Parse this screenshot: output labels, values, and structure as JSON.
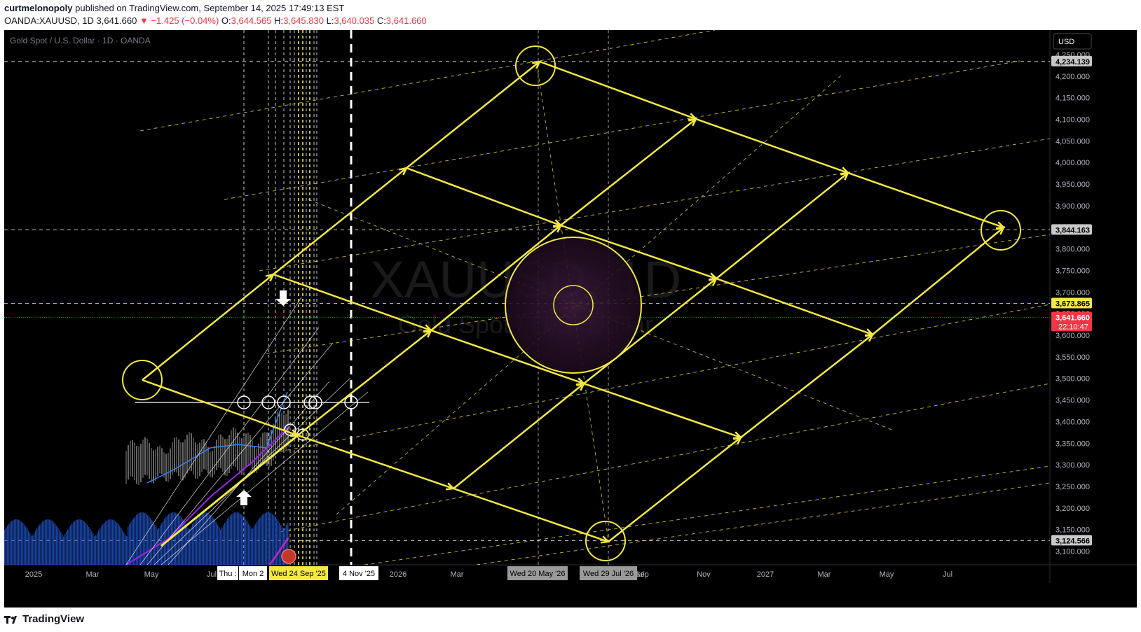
{
  "header": {
    "publisher": "curtmelonopoly",
    "published_text": "published on TradingView.com, September 14, 2025 17:49:13 EST"
  },
  "ohlc": {
    "symbol": "OANDA:XAUUSD, 1D",
    "last": "3,641.660",
    "change": "▼ −1.425 (−0.04%)",
    "o_label": "O:",
    "o": "3,644.565",
    "h_label": "H:",
    "h": "3,645.830",
    "l_label": "L:",
    "l": "3,640.035",
    "c_label": "C:",
    "c": "3,641.660"
  },
  "legend_title": "Gold Spot / U.S. Dollar · 1D · OANDA",
  "watermark": {
    "symbol": "XAUUSD, 1D",
    "name": "Gold Spot / U.S. Dollar"
  },
  "currency_button": "USD",
  "chart_data": {
    "type": "line",
    "title": "Gold Spot / U.S. Dollar · 1D · OANDA",
    "y_axis": {
      "ylim": [
        3060,
        4280
      ],
      "ticks": [
        4250,
        4200,
        4150,
        4100,
        4050,
        4000,
        3950,
        3900,
        3850,
        3800,
        3750,
        3700,
        3650,
        3600,
        3550,
        3500,
        3450,
        3400,
        3350,
        3300,
        3250,
        3200,
        3150,
        3100
      ],
      "tick_labels": [
        "4,250.000",
        "4,200.000",
        "4,150.000",
        "4,100.000",
        "4,050.000",
        "4,000.000",
        "3,950.000",
        "3,900.000",
        "3,850.000",
        "3,800.000",
        "3,750.000",
        "3,700.000",
        "3,650.000",
        "3,600.000",
        "3,550.000",
        "3,500.000",
        "3,450.000",
        "3,400.000",
        "3,350.000",
        "3,300.000",
        "3,250.000",
        "3,200.000",
        "3,150.000",
        "3,100.000"
      ]
    },
    "x_axis": {
      "labels": [
        "2025",
        "Mar",
        "May",
        "Jul",
        "2026",
        "Mar",
        "Jul",
        "Sep",
        "Nov",
        "2027",
        "Mar",
        "May",
        "Jul"
      ],
      "date_badges": [
        "Thu :",
        "Mon 2",
        "Wed 24 Sep '25",
        "4 Nov '25",
        "Wed 20 May '26",
        "Wed 29 Jul '26"
      ]
    },
    "price_levels": [
      {
        "value": 4234.139,
        "label": "4,234.139",
        "style": "dashed-white"
      },
      {
        "value": 3844.163,
        "label": "3,844.163",
        "style": "dashed-white"
      },
      {
        "value": 3673.865,
        "label": "3,673.865",
        "style": "dashed-yellow"
      },
      {
        "value": 3641.66,
        "label": "3,641.660",
        "countdown": "22:10:47",
        "style": "last-price"
      },
      {
        "value": 3124.566,
        "label": "3,124.566",
        "style": "dashed-white"
      }
    ],
    "colors": {
      "drawing": "#f4e842",
      "last_price": "#f23645",
      "volume": "#1e4fbf"
    }
  }
}
